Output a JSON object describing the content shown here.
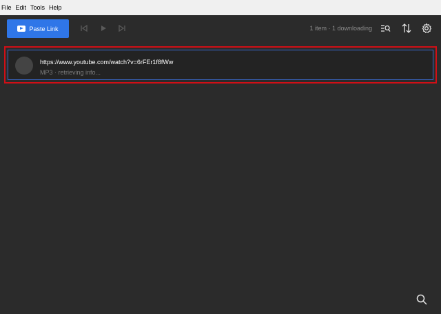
{
  "menu": [
    "File",
    "Edit",
    "Tools",
    "Help"
  ],
  "toolbar": {
    "paste_label": "Paste Link",
    "status": "1 item · 1 downloading"
  },
  "download_item": {
    "url": "https://www.youtube.com/watch?v=6rFEr1f8fWw",
    "status": "MP3 · retrieving info..."
  },
  "colors": {
    "accent": "#2f76e8",
    "highlight_border": "#d10f16",
    "background": "#2b2b2b"
  },
  "icons": [
    "youtube-icon",
    "skip-previous-icon",
    "play-icon",
    "skip-next-icon",
    "search-list-icon",
    "sort-icon",
    "gear-icon",
    "search-icon"
  ]
}
